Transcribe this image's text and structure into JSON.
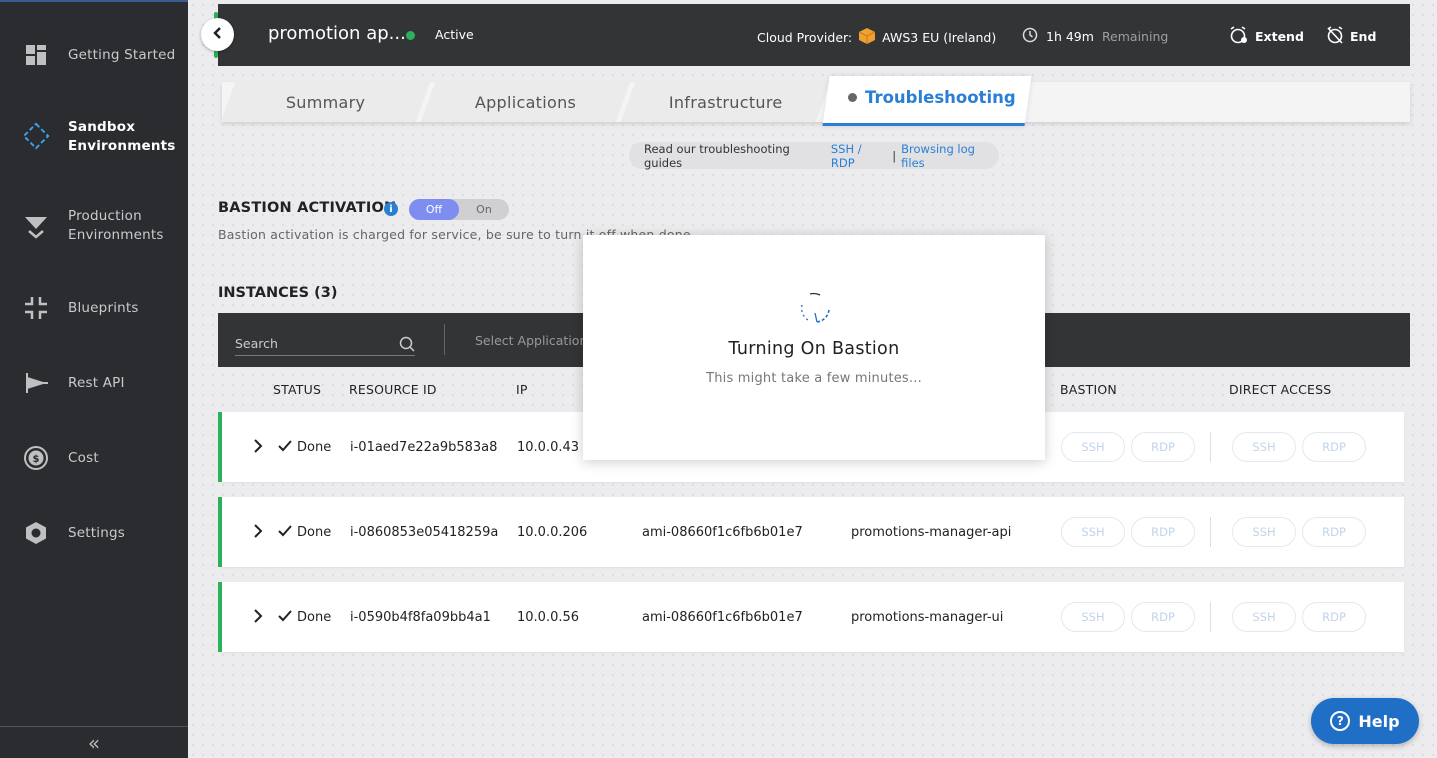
{
  "sidebar": {
    "items": [
      {
        "label": "Getting Started",
        "icon": "dashboard-icon"
      },
      {
        "label": "Sandbox\nEnvironments",
        "icon": "sandbox-icon"
      },
      {
        "label": "Production\nEnvironments",
        "icon": "production-icon"
      },
      {
        "label": "Blueprints",
        "icon": "blueprints-icon"
      },
      {
        "label": "Rest API",
        "icon": "rest-api-icon"
      },
      {
        "label": "Cost",
        "icon": "cost-icon"
      },
      {
        "label": "Settings",
        "icon": "settings-icon"
      }
    ],
    "collapse_label": "«"
  },
  "header": {
    "env_name": "promotion ap...",
    "status": "Active",
    "cloud_label": "Cloud Provider:",
    "cloud_value": "AWS3 EU (Ireland)",
    "time_value": "1h 49m",
    "time_suffix": "Remaining",
    "extend_label": "Extend",
    "end_label": "End"
  },
  "tabs": {
    "summary": "Summary",
    "applications": "Applications",
    "infrastructure": "Infrastructure",
    "troubleshooting": "Troubleshooting"
  },
  "guides": {
    "text": "Read our troubleshooting guides",
    "link1": "SSH / RDP",
    "separator": "|",
    "link2": "Browsing log files"
  },
  "bastion": {
    "title": "BASTION ACTIVATION",
    "info": "i",
    "toggle_off": "Off",
    "toggle_on": "On",
    "description": "Bastion activation is charged for service, be sure to turn it off when done"
  },
  "instances": {
    "title": "INSTANCES (3)",
    "search_placeholder": "Search",
    "select_app_placeholder": "Select Application",
    "columns": {
      "status": "STATUS",
      "resource_id": "RESOURCE ID",
      "ip": "IP",
      "bastion": "BASTION",
      "direct_access": "DIRECT ACCESS"
    },
    "rows": [
      {
        "status": "Done",
        "resource_id": "i-01aed7e22a9b583a8",
        "ip": "10.0.0.43",
        "ami": "",
        "app": ""
      },
      {
        "status": "Done",
        "resource_id": "i-0860853e05418259a",
        "ip": "10.0.0.206",
        "ami": "ami-08660f1c6fb6b01e7",
        "app": "promotions-manager-api"
      },
      {
        "status": "Done",
        "resource_id": "i-0590b4f8fa09bb4a1",
        "ip": "10.0.0.56",
        "ami": "ami-08660f1c6fb6b01e7",
        "app": "promotions-manager-ui"
      }
    ],
    "ssh_label": "SSH",
    "rdp_label": "RDP"
  },
  "modal": {
    "title": "Turning On Bastion",
    "subtitle": "This might take a few minutes..."
  },
  "help": {
    "label": "Help",
    "icon_glyph": "?"
  },
  "colors": {
    "accent_green": "#2ab15a",
    "link_blue": "#2a7fd4",
    "sidebar_bg": "#2b2c2f",
    "topbar_bg": "#333436"
  }
}
